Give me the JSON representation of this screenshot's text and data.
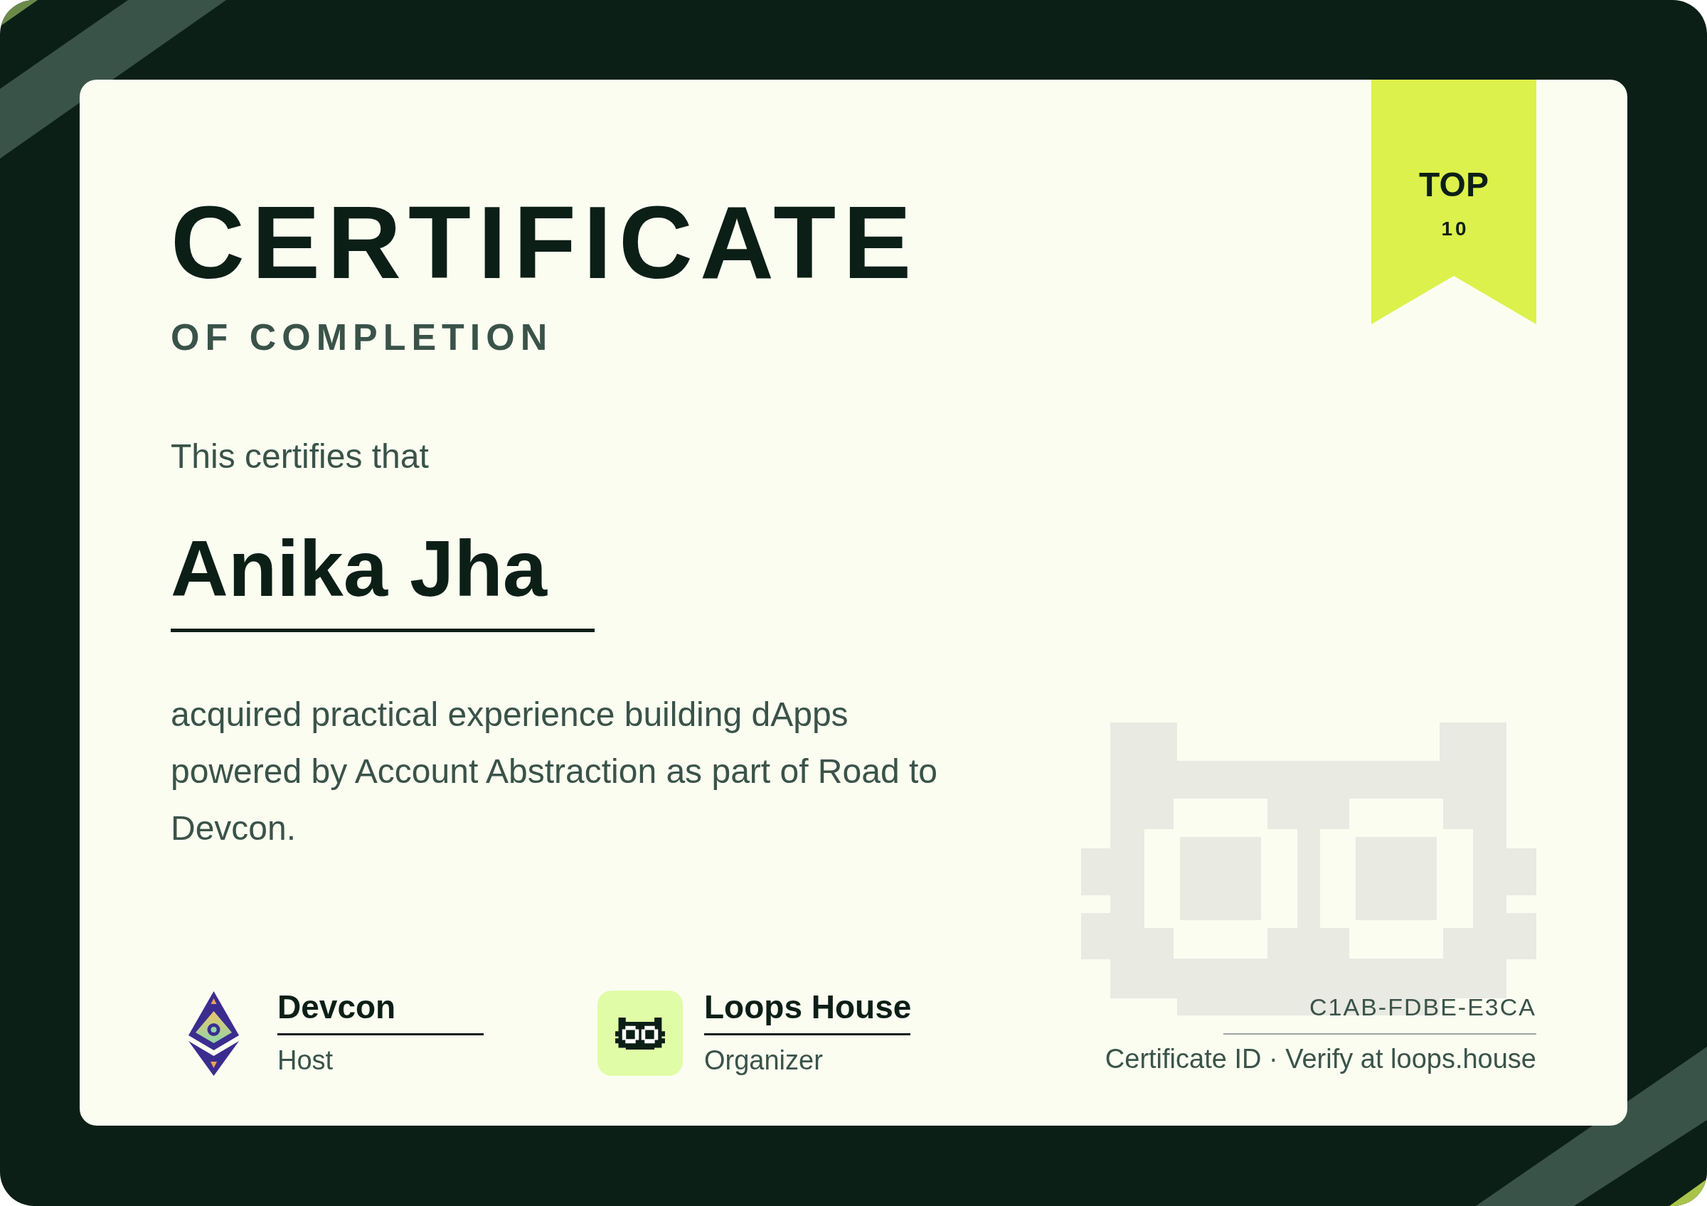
{
  "certificate": {
    "title": "CERTIFICATE",
    "subtitle": "OF COMPLETION",
    "intro": "This certifies that",
    "recipient": "Anika Jha",
    "description": "acquired practical experience building dApps powered by Account Abstraction as part of Road to Devcon."
  },
  "ribbon": {
    "label": "TOP",
    "rank": "10"
  },
  "signatories": [
    {
      "kind": "devcon",
      "name": "Devcon",
      "role": "Host"
    },
    {
      "kind": "loops",
      "name": "Loops House",
      "role": "Organizer"
    }
  ],
  "verification": {
    "certificate_id": "C1AB-FDBE-E3CA",
    "caption": "Certificate ID · Verify at loops.house"
  }
}
